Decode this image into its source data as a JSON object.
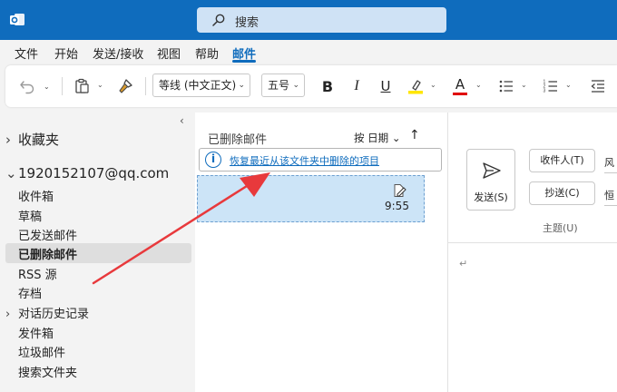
{
  "search": {
    "placeholder": "搜索"
  },
  "menu": [
    "文件",
    "开始",
    "发送/接收",
    "视图",
    "帮助",
    "邮件"
  ],
  "ribbon": {
    "font_name": "等线 (中文正文)",
    "font_size": "五号",
    "bold": "B",
    "italic": "I",
    "underline": "U",
    "font_color": "A"
  },
  "folders": {
    "favorites": "收藏夹",
    "account": "1920152107@qq.com",
    "items": [
      "收件箱",
      "草稿",
      "已发送邮件",
      "已删除邮件",
      "RSS 源",
      "存档",
      "对话历史记录",
      "发件箱",
      "垃圾邮件",
      "搜索文件夹"
    ]
  },
  "message_list": {
    "title": "已删除邮件",
    "sort_label": "按 日期",
    "sort_arrow": "↑",
    "recover_link": "恢复最近从该文件夹中删除的项目",
    "draft_time": "9:55"
  },
  "compose": {
    "send": "发送(S)",
    "to": "收件人(T)",
    "cc": "抄送(C)",
    "to_side": "风",
    "cc_side": "恒",
    "subject": "主题(U)",
    "return_mark": "↵"
  },
  "colors": {
    "accent": "#0f6cbd",
    "highlight": "#ffe600",
    "font_color": "#e00000",
    "annotation": "#e8393c"
  }
}
